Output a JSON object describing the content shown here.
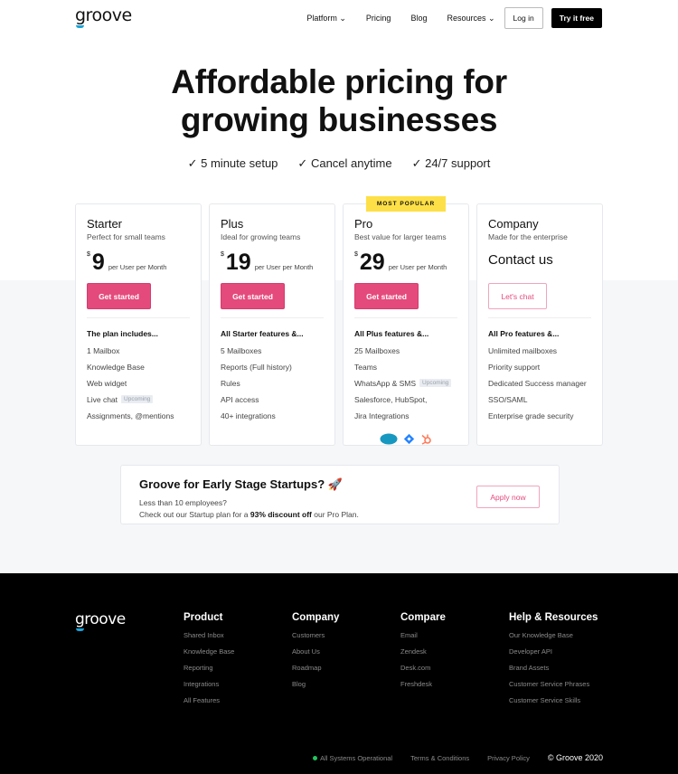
{
  "header": {
    "logo": "groove",
    "nav": [
      {
        "label": "Platform",
        "dropdown": true
      },
      {
        "label": "Pricing"
      },
      {
        "label": "Blog"
      },
      {
        "label": "Resources",
        "dropdown": true
      }
    ],
    "login": "Log in",
    "try": "Try it free"
  },
  "hero": {
    "title_line1": "Affordable pricing for",
    "title_line2": "growing businesses",
    "checks": [
      "5 minute setup",
      "Cancel anytime",
      "24/7 support"
    ]
  },
  "plans": [
    {
      "name": "Starter",
      "tagline": "Perfect for small teams",
      "currency": "$",
      "price": "9",
      "per": "per User per Month",
      "cta": "Get started",
      "features_heading": "The plan includes...",
      "features": [
        {
          "text": "1 Mailbox"
        },
        {
          "text": "Knowledge Base"
        },
        {
          "text": "Web widget"
        },
        {
          "text": "Live chat",
          "badge": "Upcoming"
        },
        {
          "text": "Assignments, @mentions"
        }
      ]
    },
    {
      "name": "Plus",
      "tagline": "Ideal for growing teams",
      "currency": "$",
      "price": "19",
      "per": "per User per Month",
      "cta": "Get started",
      "features_heading": "All Starter features &...",
      "features": [
        {
          "text": "5 Mailboxes"
        },
        {
          "text": "Reports (Full history)"
        },
        {
          "text": "Rules"
        },
        {
          "text": "API access"
        },
        {
          "text": "40+ integrations"
        }
      ]
    },
    {
      "name": "Pro",
      "badge": "MOST POPULAR",
      "tagline": "Best value for larger teams",
      "currency": "$",
      "price": "29",
      "per": "per User per Month",
      "cta": "Get started",
      "features_heading": "All Plus features &...",
      "features": [
        {
          "text": "25 Mailboxes"
        },
        {
          "text": "Teams"
        },
        {
          "text": "WhatsApp & SMS",
          "badge": "Upcoming"
        },
        {
          "text": "Salesforce, HubSpot,"
        },
        {
          "text": "Jira Integrations"
        }
      ],
      "integration_icons": [
        "salesforce-icon",
        "jira-icon",
        "hubspot-icon"
      ]
    },
    {
      "name": "Company",
      "tagline": "Made for the enterprise",
      "contact": "Contact us",
      "cta": "Let's chat",
      "features_heading": "All Pro features &...",
      "features": [
        {
          "text": "Unlimited mailboxes"
        },
        {
          "text": "Priority support"
        },
        {
          "text": "Dedicated Success manager"
        },
        {
          "text": "SSO/SAML"
        },
        {
          "text": "Enterprise grade security"
        }
      ]
    }
  ],
  "startup": {
    "title": "Groove for Early Stage Startups? 🚀",
    "line1": "Less than 10 employees?",
    "line2_pre": "Check out our Startup plan for a ",
    "line2_bold": "93% discount off",
    "line2_post": " our Pro Plan.",
    "cta": "Apply now"
  },
  "footer": {
    "logo": "groove",
    "columns": [
      {
        "heading": "Product",
        "links": [
          "Shared Inbox",
          "Knowledge Base",
          "Reporting",
          "Integrations",
          "All Features"
        ]
      },
      {
        "heading": "Company",
        "links": [
          "Customers",
          "About Us",
          "Roadmap",
          "Blog"
        ]
      },
      {
        "heading": "Compare",
        "links": [
          "Email",
          "Zendesk",
          "Desk.com",
          "Freshdesk"
        ]
      },
      {
        "heading": "Help & Resources",
        "links": [
          "Our Knowledge Base",
          "Developer API",
          "Brand Assets",
          "Customer Service Phrases",
          "Customer Service Skills"
        ]
      }
    ],
    "status": "All Systems Operational",
    "terms": "Terms & Conditions",
    "privacy": "Privacy Policy",
    "copyright": "© Groove 2020"
  },
  "colors": {
    "accent": "#e44a7c",
    "badge": "#fde047",
    "status": "#22c55e",
    "logo_smile": "#1aa3d9"
  }
}
